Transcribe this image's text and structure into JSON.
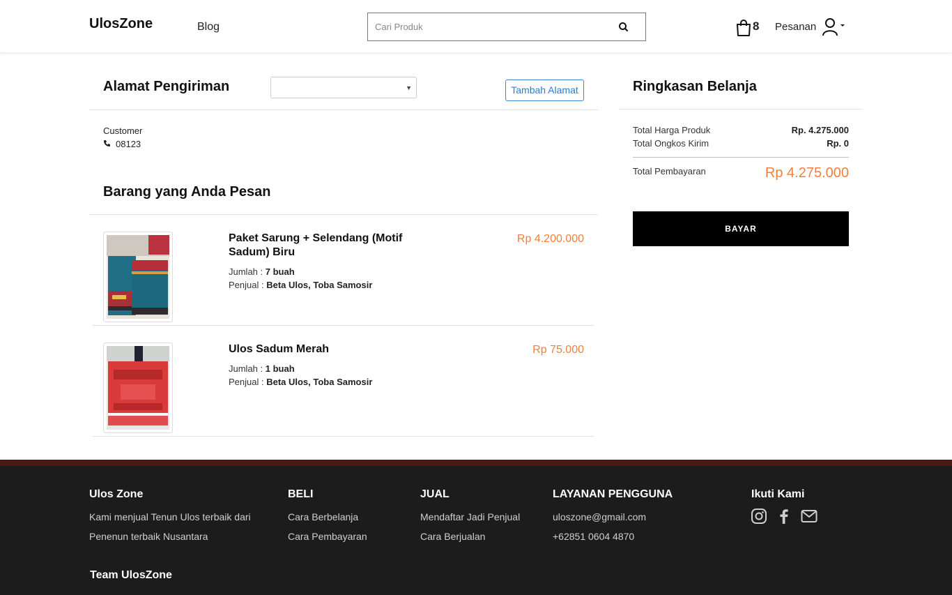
{
  "header": {
    "brand": "UlosZone",
    "nav_blog": "Blog",
    "search_placeholder": "Cari Produk",
    "cart_count": "8",
    "orders_label": "Pesanan"
  },
  "address": {
    "title": "Alamat Pengiriman",
    "select_value": "",
    "add_button": "Tambah Alamat",
    "customer_name": "Customer",
    "customer_phone": "08123"
  },
  "items_section": {
    "title": "Barang yang Anda Pesan",
    "items": [
      {
        "name": "Paket Sarung + Selendang (Motif Sadum) Biru",
        "qty_label": "Jumlah : ",
        "qty": "7 buah",
        "seller_label": "Penjual : ",
        "seller": "Beta Ulos, Toba Samosir",
        "price": "Rp 4.200.000"
      },
      {
        "name": "Ulos Sadum Merah",
        "qty_label": "Jumlah : ",
        "qty": "1 buah",
        "seller_label": "Penjual : ",
        "seller": "Beta Ulos, Toba Samosir",
        "price": "Rp 75.000"
      }
    ]
  },
  "summary": {
    "title": "Ringkasan Belanja",
    "product_total_label": "Total Harga Produk",
    "product_total_value": "Rp. 4.275.000",
    "shipping_label": "Total Ongkos Kirim",
    "shipping_value": "Rp. 0",
    "grand_total_label": "Total Pembayaran",
    "grand_total_value": "Rp 4.275.000",
    "pay_button": "BAYAR"
  },
  "footer": {
    "col1_title": "Ulos Zone",
    "col1_line1": "Kami menjual Tenun Ulos terbaik dari",
    "col1_line2": "Penenun terbaik Nusantara",
    "col2_title": "BELI",
    "col2_link1": "Cara Berbelanja",
    "col2_link2": "Cara Pembayaran",
    "col3_title": "JUAL",
    "col3_link1": "Mendaftar Jadi Penjual",
    "col3_link2": "Cara Berjualan",
    "col4_title": "LAYANAN PENGGUNA",
    "col4_email": "uloszone@gmail.com",
    "col4_phone": "+62851 0604 4870",
    "col5_title": "Ikuti Kami",
    "social_icons": [
      "instagram-icon",
      "facebook-icon",
      "email-icon"
    ],
    "team": "Team UlosZone"
  },
  "colors": {
    "accent_price": "#f07f3c",
    "link_blue": "#2d7bd2",
    "footer_bg": "#1c1c1c",
    "footer_bar": "#4a1a14"
  }
}
